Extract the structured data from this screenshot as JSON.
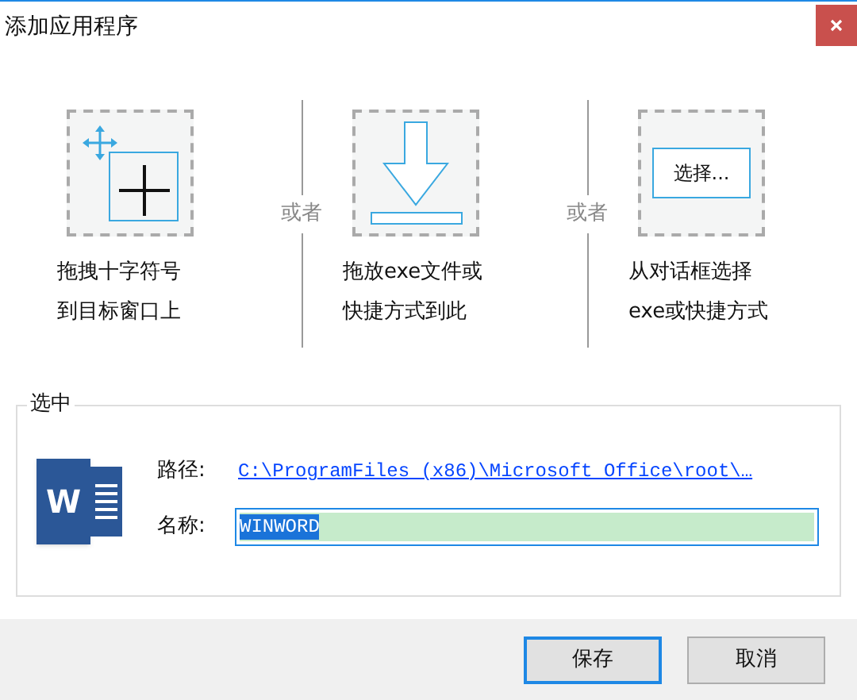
{
  "window": {
    "title": "添加应用程序"
  },
  "options": [
    {
      "kind": "crosshair",
      "caption": [
        "拖拽十字符号",
        "到目标窗口上"
      ]
    },
    {
      "kind": "drop",
      "caption": [
        "拖放exe文件或",
        "快捷方式到此"
      ]
    },
    {
      "kind": "browse",
      "button_label": "选择...",
      "caption": [
        "从对话框选择",
        "exe或快捷方式"
      ]
    }
  ],
  "separators": [
    "或者",
    "或者"
  ],
  "selection": {
    "legend": "选中",
    "icon_letter": "W",
    "path": {
      "label": "路径:",
      "value": "C:\\ProgramFiles (x86)\\Microsoft Office\\root\\…"
    },
    "name": {
      "label": "名称:",
      "value": "WINWORD",
      "selected": true
    }
  },
  "buttons": [
    {
      "label": "保存",
      "focused": true
    },
    {
      "label": "取消",
      "focused": false
    }
  ]
}
